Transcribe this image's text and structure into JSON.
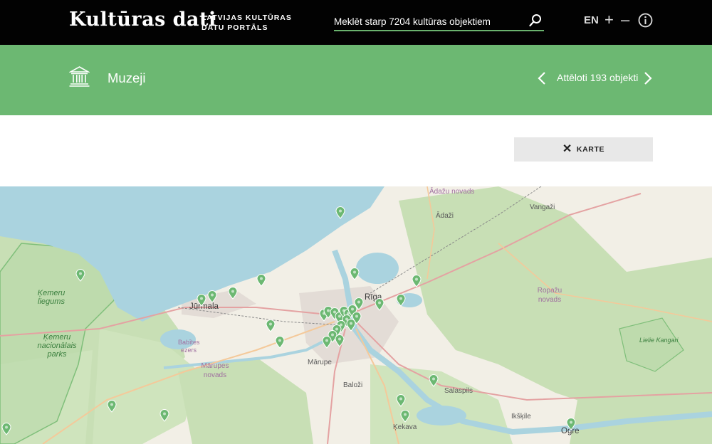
{
  "header": {
    "logo": "Kultūras dati",
    "tagline_line1": "LATVIJAS KULTŪRAS",
    "tagline_line2": "DATU PORTĀLS",
    "search_placeholder": "Meklēt starp 7204 kultūras objektiem",
    "language": "EN",
    "zoom_in": "+",
    "zoom_out": "–"
  },
  "section": {
    "title": "Muzeji",
    "count": "Attēloti 193 objekti"
  },
  "map_toggle": {
    "icon": "✕",
    "label": "KARTE"
  },
  "map": {
    "places": [
      {
        "name": "Ādažu novads",
        "cls": "region"
      },
      {
        "name": "Ādaži",
        "cls": ""
      },
      {
        "name": "Vangaži",
        "cls": ""
      },
      {
        "name": "Ropažu novads",
        "cls": "region"
      },
      {
        "name": "Jūrmala",
        "cls": "big"
      },
      {
        "name": "Ķemeru nacionālais parks",
        "cls": "park"
      },
      {
        "name": "Ķemeru liegums",
        "cls": "park"
      },
      {
        "name": "Mārupe",
        "cls": ""
      },
      {
        "name": "Mārupes novads",
        "cls": "region"
      },
      {
        "name": "Baloži",
        "cls": ""
      },
      {
        "name": "Salaspils",
        "cls": ""
      },
      {
        "name": "Ķekava",
        "cls": ""
      },
      {
        "name": "Ikšķile",
        "cls": ""
      },
      {
        "name": "Ogre",
        "cls": "big"
      },
      {
        "name": "Babītes ezers",
        "cls": "region"
      },
      {
        "name": "Lielie Kangari",
        "cls": "park"
      },
      {
        "name": "Rīga",
        "cls": "big"
      }
    ],
    "marker_color": "#6cb872",
    "water_color": "#aad3df"
  },
  "colors": {
    "header_bg": "#020202",
    "band_bg": "#6cb872",
    "accent": "#6ab36e"
  }
}
